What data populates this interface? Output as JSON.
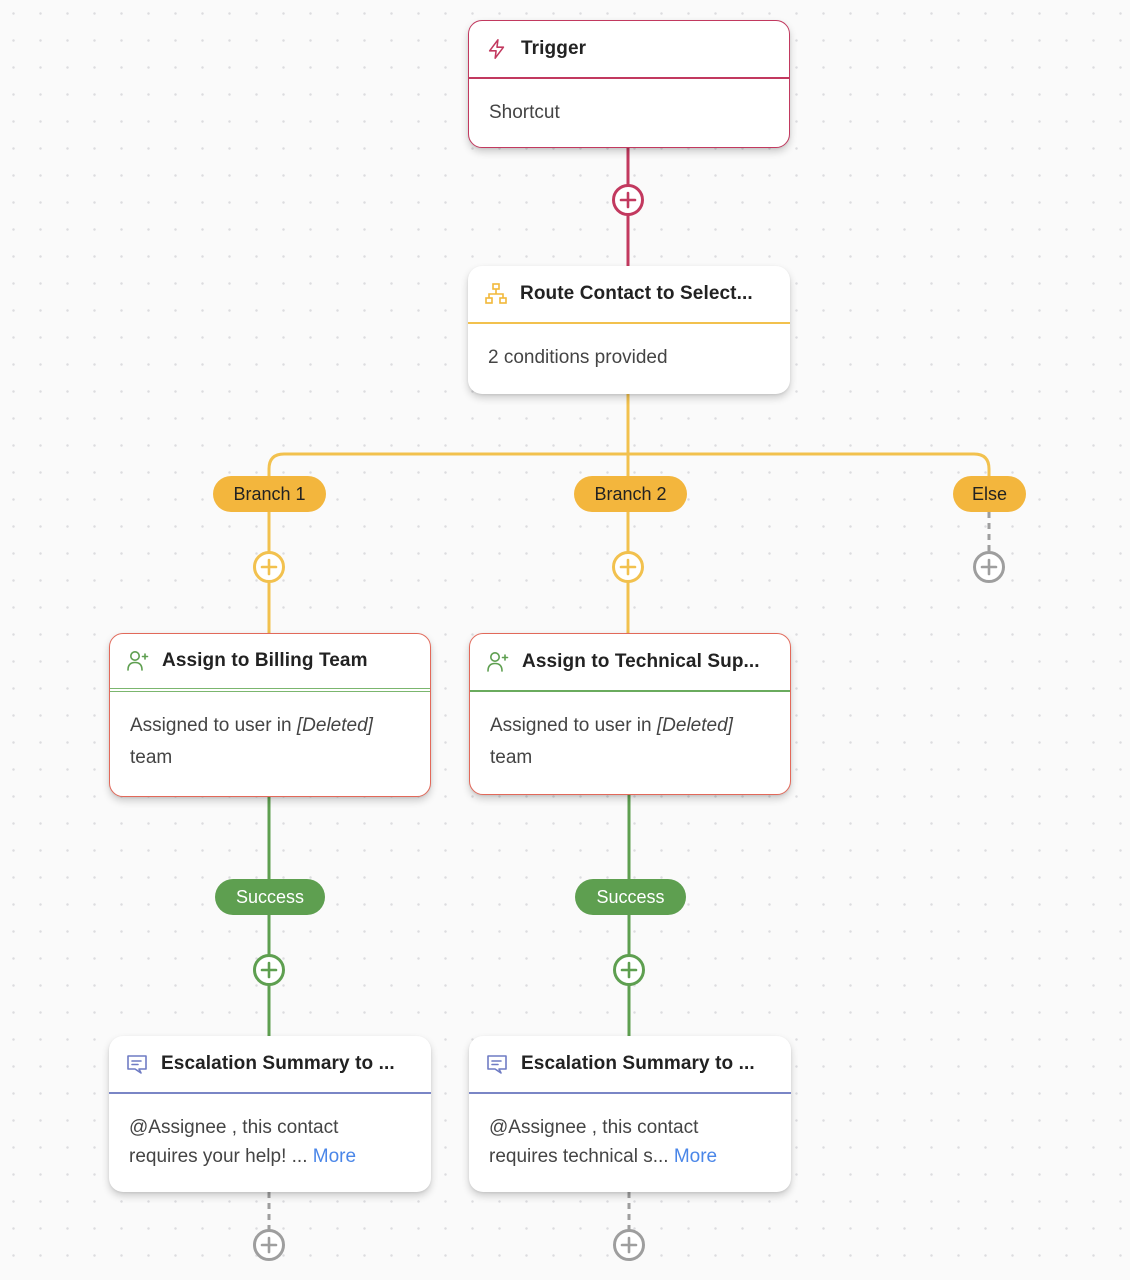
{
  "colors": {
    "trigger": "#c2395f",
    "branch": "#f2c14e",
    "branch_pill": "#f3b63d",
    "success": "#5e9f50",
    "assign_border": "#e2695a",
    "message": "#7a86c6",
    "empty_connector": "#9e9e9e",
    "link": "#4a86e8"
  },
  "trigger": {
    "icon": "lightning-icon",
    "title": "Trigger",
    "body": "Shortcut"
  },
  "route": {
    "icon": "hierarchy-icon",
    "title": "Route Contact to Select...",
    "body": "2 conditions provided"
  },
  "branches": [
    {
      "label": "Branch 1"
    },
    {
      "label": "Branch 2"
    },
    {
      "label": "Else"
    }
  ],
  "assign_nodes": [
    {
      "icon": "user-plus-icon",
      "title": "Assign to Billing Team",
      "body_prefix": "Assigned to user in ",
      "body_italic": "[Deleted]",
      "body_suffix": "team"
    },
    {
      "icon": "user-plus-icon",
      "title": "Assign to Technical Sup...",
      "body_prefix": "Assigned to user in ",
      "body_italic": "[Deleted]",
      "body_suffix": "team"
    }
  ],
  "outcomes": [
    {
      "label": "Success"
    },
    {
      "label": "Success"
    }
  ],
  "message_nodes": [
    {
      "icon": "message-icon",
      "title": "Escalation Summary to ...",
      "line1": "@Assignee , this contact",
      "line2": "requires your help! ... ",
      "more": "More"
    },
    {
      "icon": "message-icon",
      "title": "Escalation Summary to ...",
      "line1": "@Assignee , this contact",
      "line2": "requires technical s... ",
      "more": "More"
    }
  ]
}
